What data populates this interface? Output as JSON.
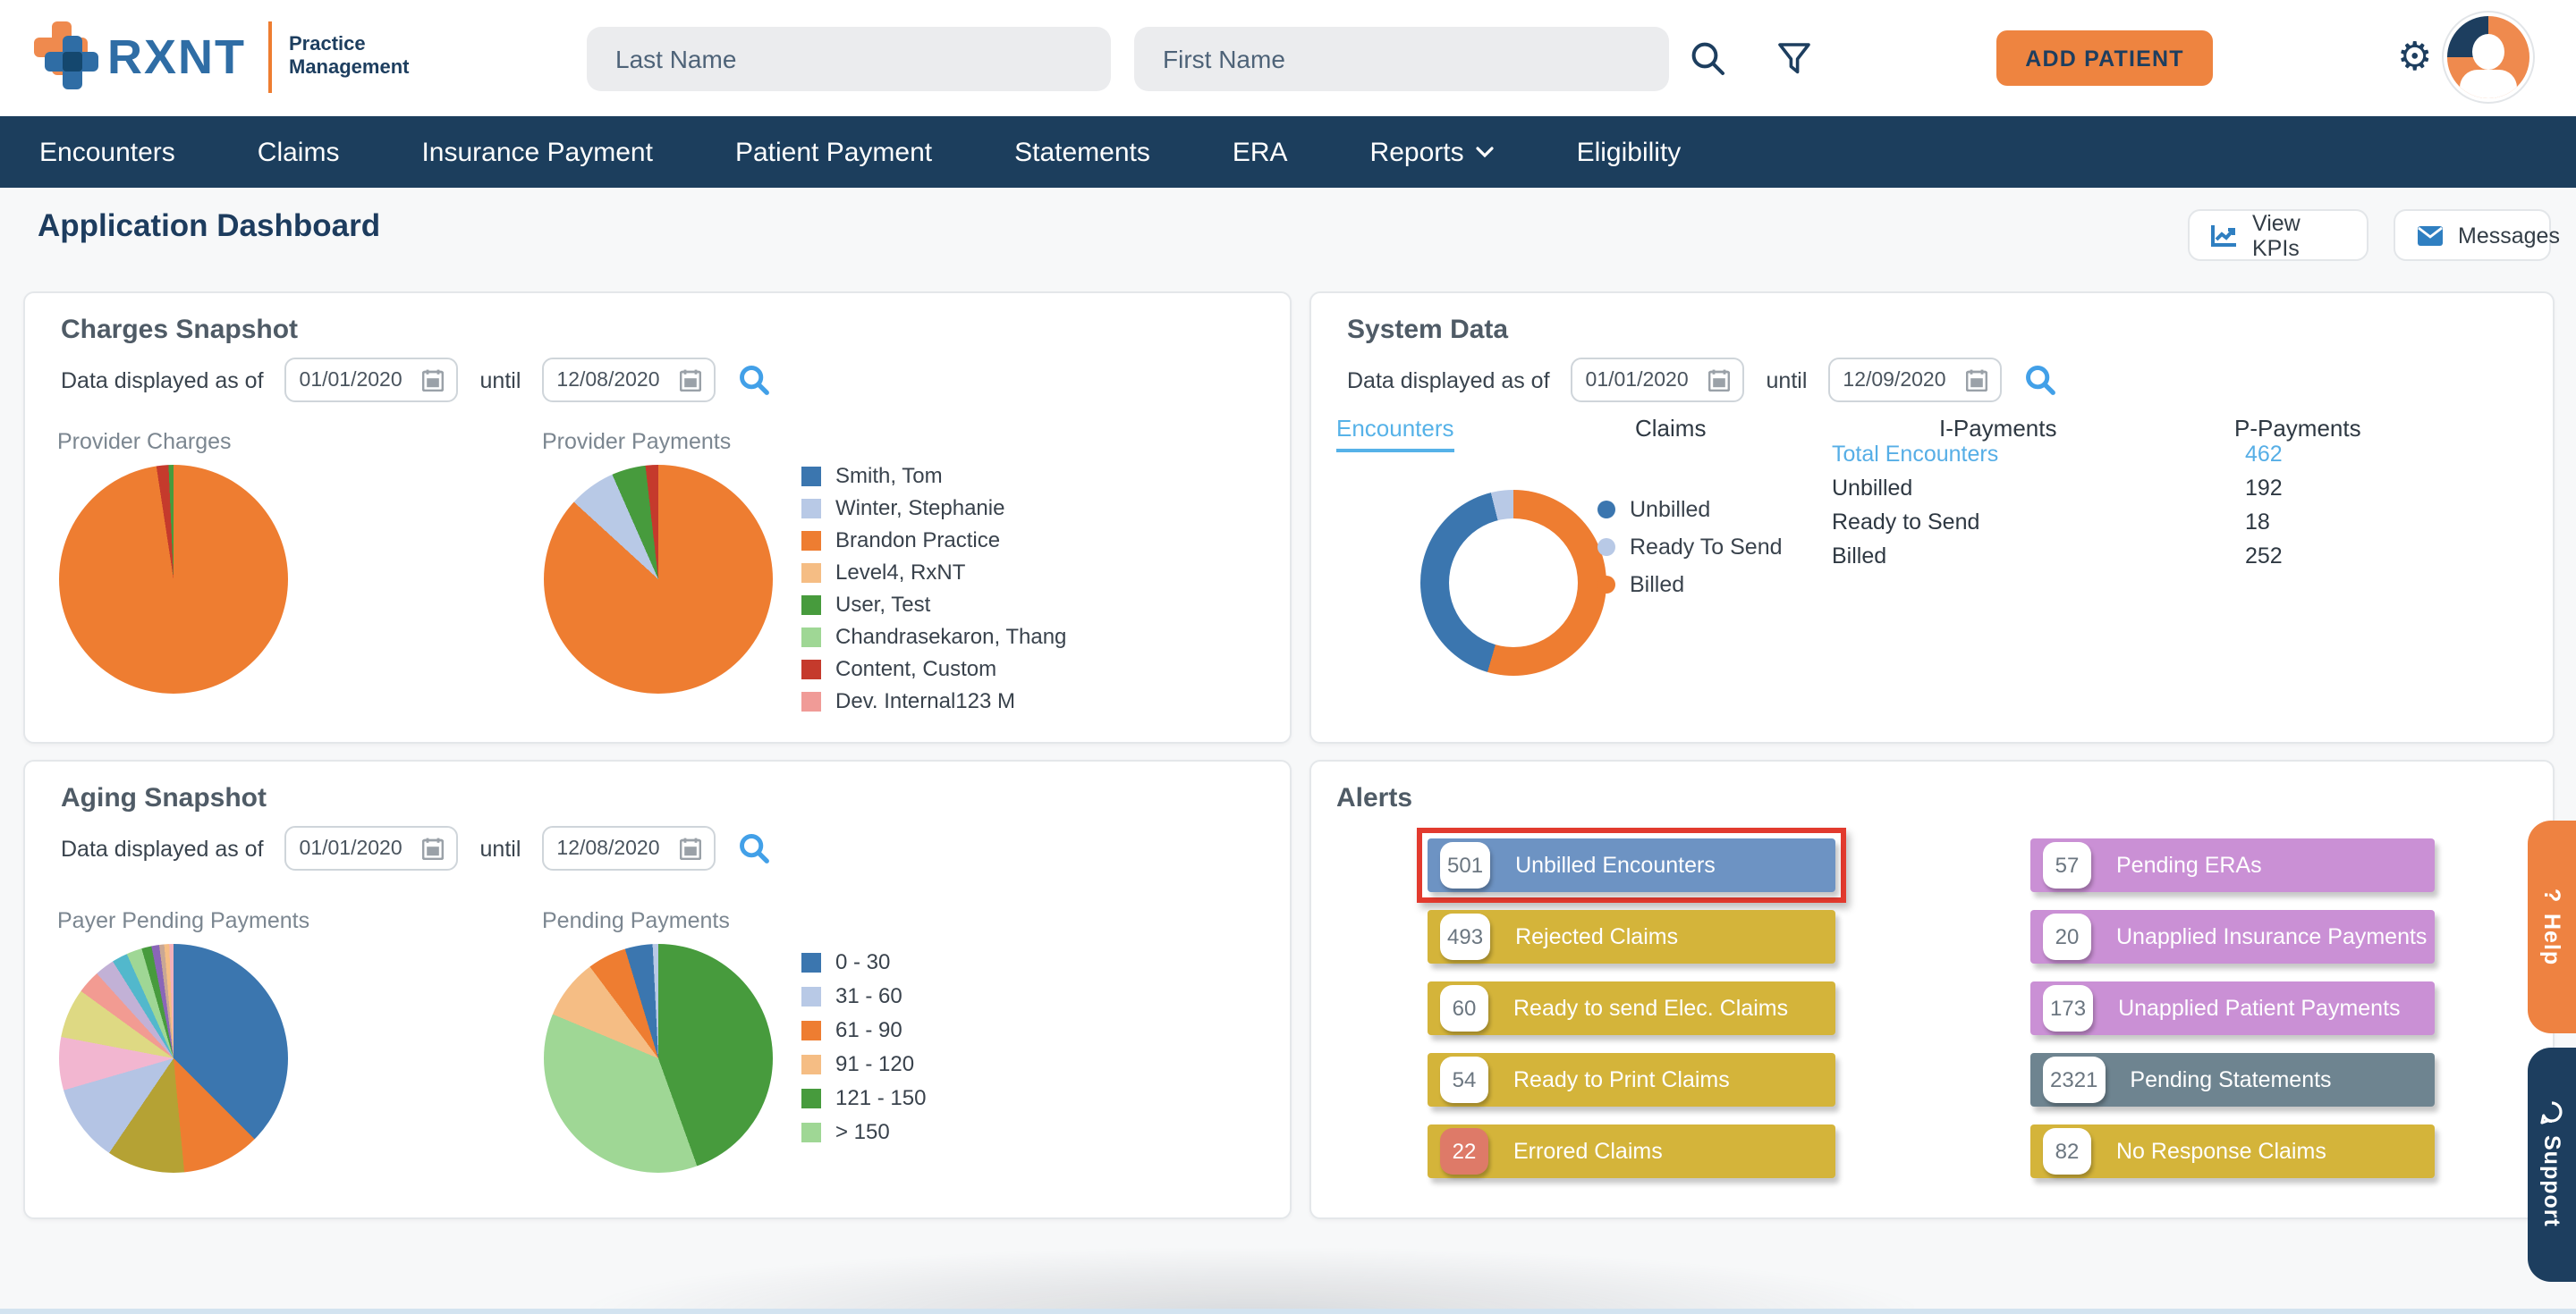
{
  "header": {
    "brand": "RXNT",
    "product": {
      "line1": "Practice",
      "line2": "Management"
    },
    "last_name_placeholder": "Last Name",
    "first_name_placeholder": "First Name",
    "add_patient_label": "ADD PATIENT"
  },
  "nav": {
    "items": [
      {
        "label": "Encounters"
      },
      {
        "label": "Claims"
      },
      {
        "label": "Insurance Payment"
      },
      {
        "label": "Patient Payment"
      },
      {
        "label": "Statements"
      },
      {
        "label": "ERA"
      },
      {
        "label": "Reports",
        "has_dropdown": true
      },
      {
        "label": "Eligibility"
      }
    ]
  },
  "page": {
    "title": "Application Dashboard",
    "view_kpis_label": "View KPIs",
    "messages_label": "Messages"
  },
  "charges_snapshot": {
    "title": "Charges Snapshot",
    "date_prefix": "Data displayed as of",
    "date_from": "01/01/2020",
    "until_label": "until",
    "date_to": "12/08/2020",
    "chart1_title": "Provider Charges",
    "chart2_title": "Provider Payments",
    "legend": [
      {
        "label": "Smith, Tom",
        "color": "#3b76af"
      },
      {
        "label": "Winter, Stephanie",
        "color": "#b8c9e6"
      },
      {
        "label": "Brandon Practice",
        "color": "#ee7d31"
      },
      {
        "label": "Level4, RxNT",
        "color": "#f5bd84"
      },
      {
        "label": "User, Test",
        "color": "#479b3d"
      },
      {
        "label": "Chandrasekaron, Thang",
        "color": "#9fd795"
      },
      {
        "label": "Content, Custom",
        "color": "#c53a2c"
      },
      {
        "label": "Dev. Internal123 M",
        "color": "#f09b97"
      }
    ]
  },
  "system_data": {
    "title": "System Data",
    "date_prefix": "Data displayed as of",
    "date_from": "01/01/2020",
    "until_label": "until",
    "date_to": "12/09/2020",
    "tabs": [
      {
        "label": "Encounters",
        "active": true
      },
      {
        "label": "Claims"
      },
      {
        "label": "I-Payments"
      },
      {
        "label": "P-Payments"
      }
    ],
    "legend": [
      {
        "label": "Unbilled",
        "color": "#3b76af"
      },
      {
        "label": "Ready To Send",
        "color": "#b8c9e6"
      },
      {
        "label": "Billed",
        "color": "#ee7d31"
      }
    ],
    "stats": [
      {
        "label": "Total Encounters",
        "value": "462"
      },
      {
        "label": "Unbilled",
        "value": "192"
      },
      {
        "label": "Ready to Send",
        "value": "18"
      },
      {
        "label": "Billed",
        "value": "252"
      }
    ]
  },
  "aging_snapshot": {
    "title": "Aging Snapshot",
    "date_prefix": "Data displayed as of",
    "date_from": "01/01/2020",
    "until_label": "until",
    "date_to": "12/08/2020",
    "chart1_title": "Payer Pending Payments",
    "chart2_title": "Pending Payments",
    "legend": [
      {
        "label": "0 - 30",
        "color": "#3b76af"
      },
      {
        "label": "31 - 60",
        "color": "#b8c9e6"
      },
      {
        "label": "61 - 90",
        "color": "#ee7d31"
      },
      {
        "label": "91 - 120",
        "color": "#f5bd84"
      },
      {
        "label": "121 - 150",
        "color": "#479b3d"
      },
      {
        "label": "> 150",
        "color": "#9fd795"
      }
    ]
  },
  "alerts": {
    "title": "Alerts",
    "left": [
      {
        "count": "501",
        "label": "Unbilled Encounters",
        "color": "#6d93c3",
        "badge_bg": "#ffffff",
        "badge_fg": "#6b7680",
        "highlighted": true
      },
      {
        "count": "493",
        "label": "Rejected Claims",
        "color": "#d4b43a",
        "badge_bg": "#ffffff",
        "badge_fg": "#6b7680"
      },
      {
        "count": "60",
        "label": "Ready to send Elec. Claims",
        "color": "#d4b43a",
        "badge_bg": "#ffffff",
        "badge_fg": "#6b7680"
      },
      {
        "count": "54",
        "label": "Ready to Print Claims",
        "color": "#d4b43a",
        "badge_bg": "#ffffff",
        "badge_fg": "#6b7680"
      },
      {
        "count": "22",
        "label": "Errored Claims",
        "color": "#d4b43a",
        "badge_bg": "#de7a68",
        "badge_fg": "#ffffff"
      }
    ],
    "right": [
      {
        "count": "57",
        "label": "Pending ERAs",
        "color": "#ca90d5",
        "badge_bg": "#ffffff",
        "badge_fg": "#6b7680"
      },
      {
        "count": "20",
        "label": "Unapplied Insurance Payments",
        "color": "#ca90d5",
        "badge_bg": "#ffffff",
        "badge_fg": "#6b7680"
      },
      {
        "count": "173",
        "label": "Unapplied Patient Payments",
        "color": "#ca90d5",
        "badge_bg": "#ffffff",
        "badge_fg": "#6b7680"
      },
      {
        "count": "2321",
        "label": "Pending Statements",
        "color": "#6e8490",
        "badge_bg": "#ffffff",
        "badge_fg": "#6b7680"
      },
      {
        "count": "82",
        "label": "No Response Claims",
        "color": "#d4b43a",
        "badge_bg": "#ffffff",
        "badge_fg": "#6b7680"
      }
    ]
  },
  "side_tabs": {
    "help": {
      "icon": "?",
      "label": "Help",
      "color": "#ee8241"
    },
    "support": {
      "label": "Support",
      "color": "#1d3e5f"
    }
  },
  "chart_data": [
    {
      "type": "pie",
      "title": "Provider Charges",
      "panel": "Charges Snapshot",
      "legend_position": "right",
      "slices": [
        {
          "label": "Brandon Practice",
          "color": "#ee7d31",
          "pct": 97.6
        },
        {
          "label": "Content, Custom",
          "color": "#c53a2c",
          "pct": 1.7
        },
        {
          "label": "User, Test",
          "color": "#479b3d",
          "pct": 0.7
        }
      ]
    },
    {
      "type": "pie",
      "title": "Provider Payments",
      "panel": "Charges Snapshot",
      "legend_position": "right",
      "slices": [
        {
          "label": "Brandon Practice",
          "color": "#ee7d31",
          "pct": 86.8
        },
        {
          "label": "Winter, Stephanie",
          "color": "#b8c9e6",
          "pct": 6.6
        },
        {
          "label": "User, Test",
          "color": "#479b3d",
          "pct": 4.8
        },
        {
          "label": "Content, Custom",
          "color": "#c53a2c",
          "pct": 1.8
        }
      ]
    },
    {
      "type": "donut",
      "title": "Encounters",
      "panel": "System Data",
      "total": 462,
      "slices": [
        {
          "label": "Billed",
          "color": "#ee7d31",
          "value": 252,
          "pct": 54.5
        },
        {
          "label": "Unbilled",
          "color": "#3b76af",
          "value": 192,
          "pct": 41.6
        },
        {
          "label": "Ready To Send",
          "color": "#b8c9e6",
          "value": 18,
          "pct": 3.9
        }
      ]
    },
    {
      "type": "pie",
      "title": "Payer Pending Payments",
      "panel": "Aging Snapshot",
      "slices": [
        {
          "color": "#3b76af",
          "pct": 37.5
        },
        {
          "color": "#ee7d31",
          "pct": 11
        },
        {
          "color": "#b5a234",
          "pct": 11
        },
        {
          "color": "#b4c4e4",
          "pct": 11
        },
        {
          "color": "#f2b6d0",
          "pct": 7.5
        },
        {
          "color": "#ded983",
          "pct": 7
        },
        {
          "color": "#f29b92",
          "pct": 3.3
        },
        {
          "color": "#c2b1d6",
          "pct": 2.8
        },
        {
          "color": "#52b8cc",
          "pct": 2.2
        },
        {
          "color": "#9fd795",
          "pct": 2.2
        },
        {
          "color": "#479b3d",
          "pct": 1.4
        },
        {
          "color": "#8a66b8",
          "pct": 1.1
        },
        {
          "color": "#c9a794",
          "pct": 0.7
        },
        {
          "color": "#f5bd84",
          "pct": 0.7
        },
        {
          "color": "#f3b0ba",
          "pct": 0.6
        }
      ]
    },
    {
      "type": "pie",
      "title": "Pending Payments",
      "panel": "Aging Snapshot",
      "legend_position": "right",
      "slices": [
        {
          "label": "121 - 150",
          "color": "#479b3d",
          "pct": 44.5
        },
        {
          "label": "> 150",
          "color": "#9fd795",
          "pct": 36.8
        },
        {
          "label": "91 - 120",
          "color": "#f5bd84",
          "pct": 8.5
        },
        {
          "label": "61 - 90",
          "color": "#ee7d31",
          "pct": 5.5
        },
        {
          "label": "0 - 30",
          "color": "#3b76af",
          "pct": 3.9
        },
        {
          "label": "31 - 60",
          "color": "#b8c9e6",
          "pct": 0.8
        }
      ]
    }
  ]
}
